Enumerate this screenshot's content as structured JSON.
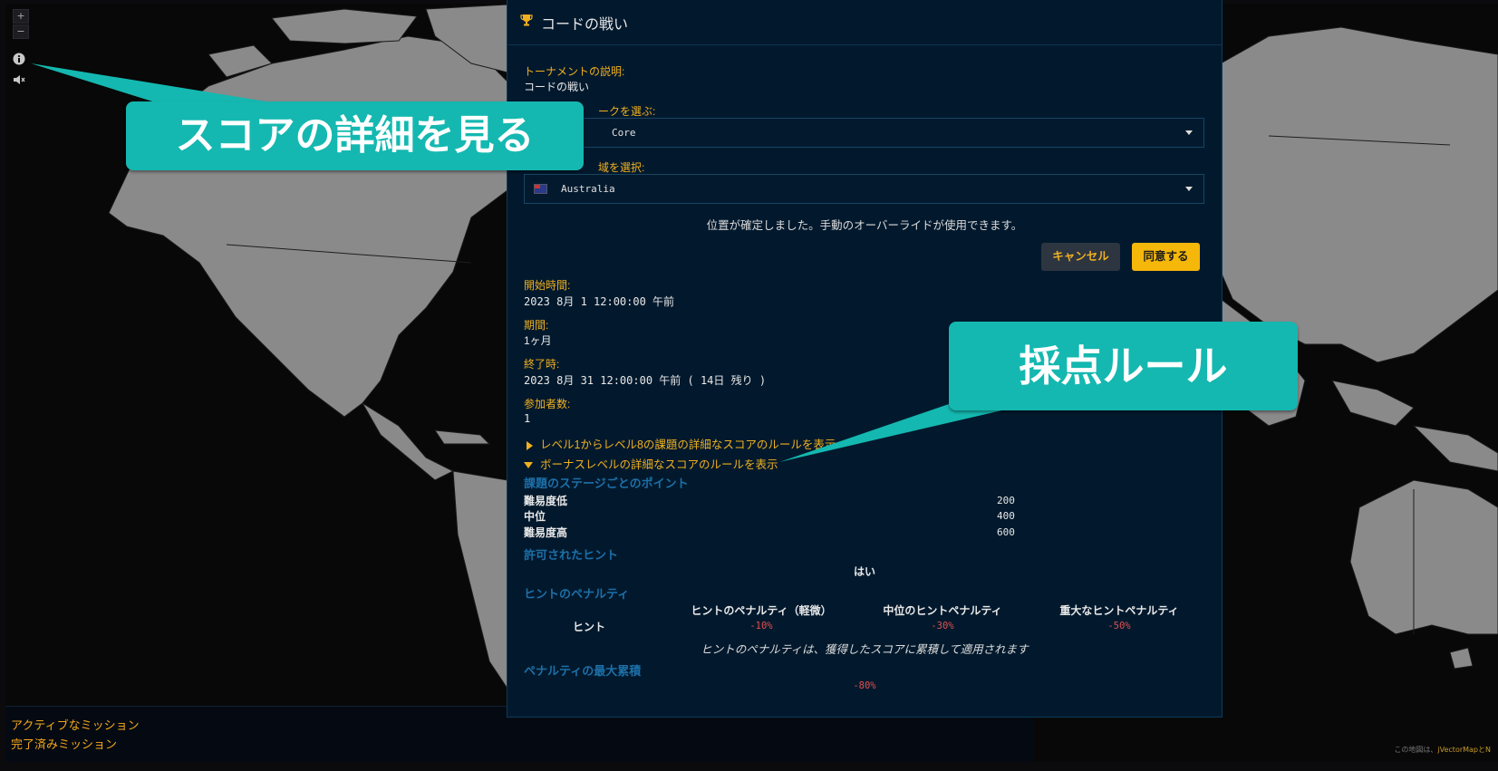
{
  "map": {
    "zoom_in": "+",
    "zoom_out": "−",
    "info_icon": "info-icon",
    "mute_icon": "speaker-mute-icon"
  },
  "bottom_bar": {
    "active_missions": "アクティブなミッション",
    "completed_missions": "完了済みミッション"
  },
  "attribution": {
    "prefix": "この地図は、",
    "link": "jVectorMapとN"
  },
  "modal": {
    "title": "コードの戦い",
    "description_label": "トーナメントの説明:",
    "description_value": "コードの戦い",
    "network_label": "ークを選ぶ:",
    "network_value": "Core",
    "region_label": "域を選択:",
    "region_value": "Australia",
    "notice": "位置が確定しました。手動のオーバーライドが使用できます。",
    "cancel_button": "キャンセル",
    "agree_button": "同意する",
    "start_label": "開始時間:",
    "start_value": "2023 8月 1 12:00:00 午前",
    "duration_label": "期間:",
    "duration_value": "1ヶ月",
    "end_label": "終了時:",
    "end_value": "2023 8月 31 12:00:00 午前 ( 14日 残り )",
    "participants_label": "参加者数:",
    "participants_value": "1",
    "toggle_levels": "レベル1からレベル8の課題の詳細なスコアのルールを表示",
    "toggle_bonus": "ボーナスレベルの詳細なスコアのルールを表示",
    "points_section": "課題のステージごとのポイント",
    "points": [
      {
        "label": "難易度低",
        "value": "200"
      },
      {
        "label": "中位",
        "value": "400"
      },
      {
        "label": "難易度高",
        "value": "600"
      }
    ],
    "hints_allowed_section": "許可されたヒント",
    "hints_allowed_value": "はい",
    "hint_penalty_section": "ヒントのペナルティ",
    "penalty_headers": [
      "ヒントのペナルティ（軽微）",
      "中位のヒントペナルティ",
      "重大なヒントペナルティ"
    ],
    "penalty_row_label": "ヒント",
    "penalty_values": [
      "-10%",
      "-30%",
      "-50%"
    ],
    "penalty_note": "ヒントのペナルティは、獲得したスコアに累積して適用されます",
    "max_penalty_section": "ペナルティの最大累積",
    "max_penalty_value": "-80%"
  },
  "callouts": {
    "score_details": "スコアの詳細を見る",
    "scoring_rules": "採点ルール"
  },
  "colors": {
    "accent": "#f0b020",
    "section": "#1d6fa8",
    "callout": "#14b8b0",
    "penalty": "#e05050"
  }
}
